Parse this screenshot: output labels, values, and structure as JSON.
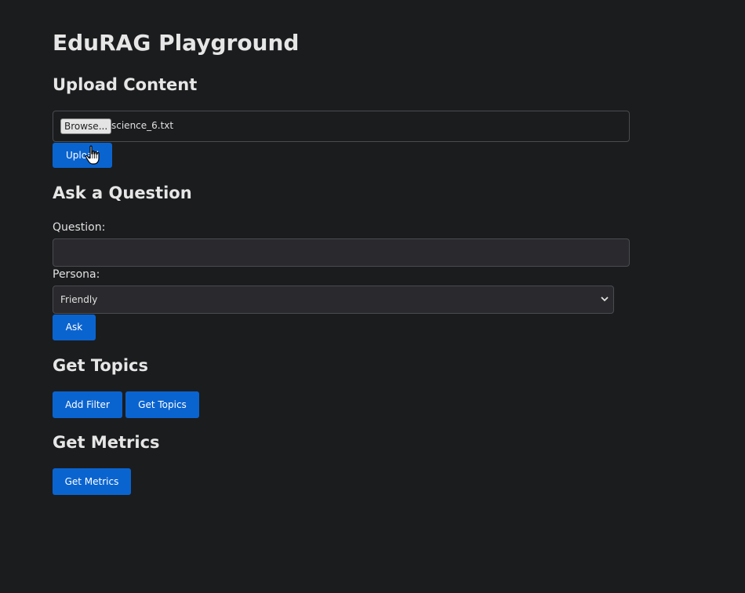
{
  "app": {
    "title": "EduRAG Playground"
  },
  "upload": {
    "heading": "Upload Content",
    "browse_label": "Browse...",
    "file_name": "science_6.txt",
    "upload_label": "Upload"
  },
  "ask": {
    "heading": "Ask a Question",
    "question_label": "Question:",
    "question_value": "",
    "persona_label": "Persona:",
    "persona_selected": "Friendly",
    "ask_label": "Ask"
  },
  "topics": {
    "heading": "Get Topics",
    "add_filter_label": "Add Filter",
    "get_topics_label": "Get Topics"
  },
  "metrics": {
    "heading": "Get Metrics",
    "get_metrics_label": "Get Metrics"
  },
  "colors": {
    "background": "#1b1c1e",
    "accent": "#0a64d0",
    "text": "#e6e6e6"
  },
  "icons": {
    "cursor": "hand-pointer-icon",
    "select_arrow": "chevron-down-icon"
  }
}
